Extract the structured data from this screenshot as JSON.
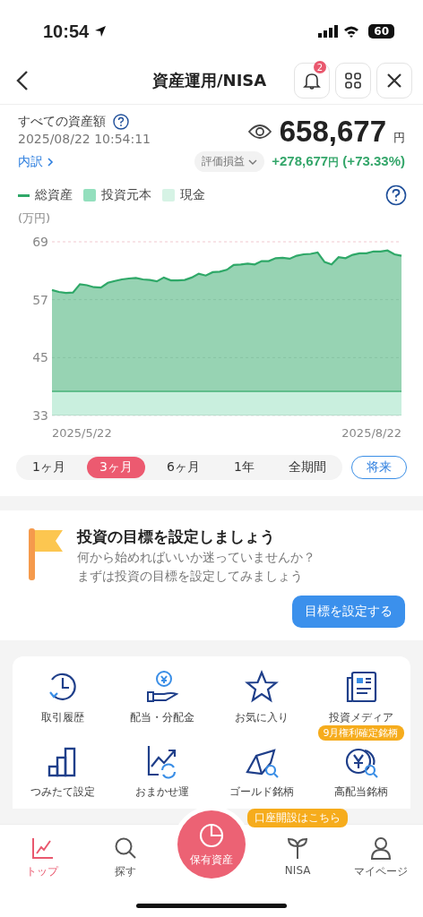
{
  "status_bar": {
    "time": "10:54",
    "battery": "60"
  },
  "header": {
    "title": "資産運用/NISA",
    "notification_count": "2"
  },
  "summary": {
    "label": "すべての資産額",
    "timestamp": "2025/08/22 10:54:11",
    "breakdown_link": "内訳",
    "amount": "658,677",
    "currency": "円",
    "filter": "評価損益",
    "gain": "+278,677",
    "gain_currency": "円",
    "gain_percent": "(+73.33%)"
  },
  "chart": {
    "cash_legend": {
      "label": "現金",
      "color": "#d6f3e5"
    },
    "start_date": "2025/5/22",
    "end_date": "2025/8/22",
    "chart_data": {
      "type": "area",
      "ylabel": "(万円)",
      "ylim": [
        33,
        69
      ],
      "yticks": [
        33,
        45,
        57,
        69
      ],
      "series": [
        {
          "name": "総資産",
          "color": "#2fa868",
          "values": [
            59,
            58.6,
            58.4,
            58.5,
            60.2,
            60.0,
            59.6,
            59.5,
            60.5,
            60.9,
            61.2,
            61.4,
            61.5,
            61.2,
            61.1,
            60.8,
            61.6,
            61.0,
            61.0,
            61.1,
            61.6,
            62.4,
            62.0,
            62.7,
            62.8,
            63.2,
            64.2,
            64.3,
            64.5,
            64.3,
            65.0,
            65.0,
            65.6,
            65.7,
            65.5,
            66.1,
            66.4,
            66.5,
            66.8,
            64.8,
            64.3,
            65.8,
            65.6,
            66.3,
            66.6,
            66.6,
            67.0,
            67.0,
            67.2,
            66.4,
            66.1
          ]
        },
        {
          "name": "投資元本",
          "color": "#93dfbd",
          "values": [
            38,
            38,
            38,
            38,
            38,
            38,
            38,
            38,
            38,
            38,
            38,
            38,
            38,
            38,
            38,
            38,
            38,
            38,
            38,
            38,
            38,
            38,
            38,
            38,
            38,
            38,
            38,
            38,
            38,
            38,
            38,
            38,
            38,
            38,
            38,
            38,
            38,
            38,
            38,
            38,
            38,
            38,
            38,
            38,
            38,
            38,
            38,
            38,
            38,
            38,
            38
          ]
        }
      ]
    }
  },
  "periods": [
    {
      "label": "1ヶ月",
      "selected": false
    },
    {
      "label": "3ヶ月",
      "selected": true
    },
    {
      "label": "6ヶ月",
      "selected": false
    },
    {
      "label": "1年",
      "selected": false
    },
    {
      "label": "全期間",
      "selected": false
    }
  ],
  "future_button": "将来",
  "goal": {
    "title": "投資の目標を設定しましょう",
    "text_1": "何から始めればいいか迷っていませんか？",
    "text_2": "まずは投資の目標を設定してみましょう",
    "button": "目標を設定する"
  },
  "shortcuts": [
    {
      "label": "取引履歴",
      "kind": "history"
    },
    {
      "label": "配当・分配金",
      "kind": "dividend"
    },
    {
      "label": "お気に入り",
      "kind": "favorite"
    },
    {
      "label": "投資メディア",
      "kind": "media"
    },
    {
      "label": "つみたて設定",
      "kind": "tsumitate"
    },
    {
      "label": "おまかせ運",
      "kind": "robo"
    },
    {
      "label": "ゴールド銘柄",
      "kind": "gold"
    },
    {
      "label": "高配当銘柄",
      "kind": "dividend-search",
      "badge": "9月権利確定銘柄"
    }
  ],
  "tab_bar": [
    {
      "label": "トップ",
      "kind": "top",
      "selected": true
    },
    {
      "label": "探す",
      "kind": "search",
      "selected": false
    },
    {
      "label": "NISA",
      "kind": "nisa",
      "selected": false,
      "tooltip": "口座開設はこちら"
    },
    {
      "label": "マイページ",
      "kind": "mypage",
      "selected": false
    }
  ],
  "center_button": {
    "label": "保有資産"
  }
}
